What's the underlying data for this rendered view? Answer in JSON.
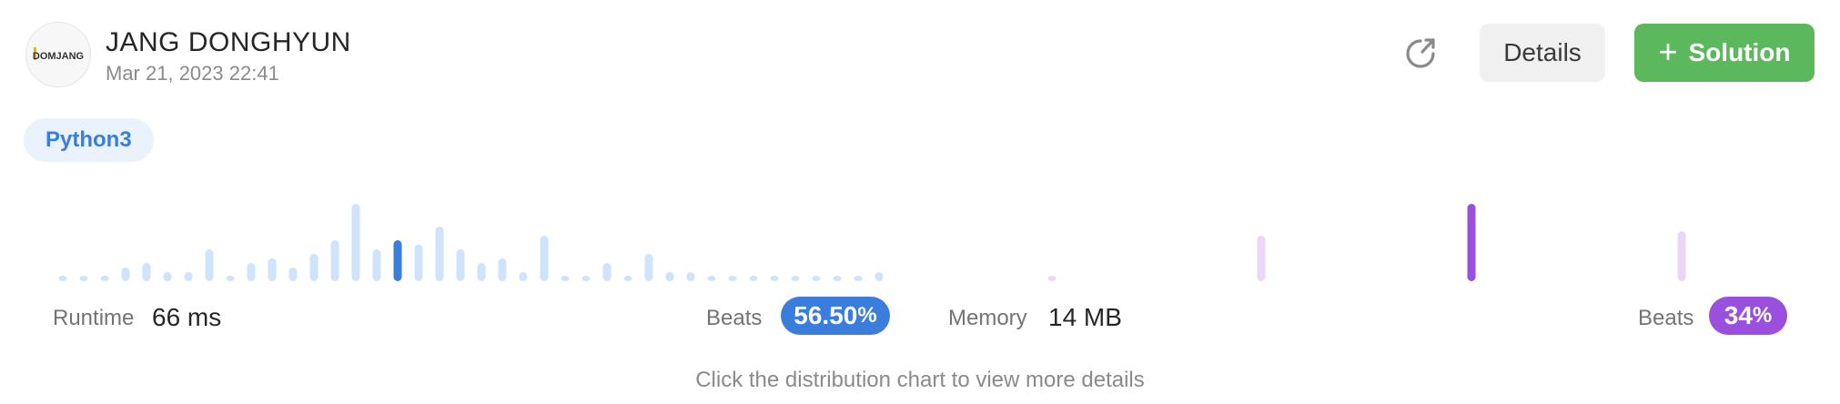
{
  "user": {
    "name": "JANG DONGHYUN",
    "date": "Mar 21, 2023 22:41",
    "avatar_text": "DOMJANG"
  },
  "actions": {
    "details_label": "Details",
    "solution_label": "Solution",
    "solution_plus": "+"
  },
  "language": "Python3",
  "runtime": {
    "label": "Runtime",
    "value": "66 ms",
    "beats_label": "Beats",
    "beats_main": "56.50",
    "beats_unit": "%",
    "accent": "#3b7ddd",
    "muted": "#cfe3fb"
  },
  "memory": {
    "label": "Memory",
    "value": "14 MB",
    "beats_label": "Beats",
    "beats_main": "34",
    "beats_unit": "%",
    "accent": "#9b4fdd",
    "muted": "#ead6f7"
  },
  "hint": "Click the distribution chart to view more details",
  "chart_data": [
    {
      "type": "bar",
      "series": [
        {
          "values": [
            1,
            1,
            1,
            3,
            4,
            2,
            2,
            7,
            1,
            4,
            5,
            3,
            6,
            9,
            17,
            7,
            9,
            8,
            12,
            7,
            4,
            5,
            2,
            10,
            1,
            1,
            4,
            1,
            6,
            2,
            2,
            1,
            1,
            1,
            1,
            1,
            1,
            1,
            1,
            2
          ]
        }
      ],
      "highlight_index": 16
    },
    {
      "type": "bar",
      "series": [
        {
          "values": [
            1,
            10,
            17,
            11
          ]
        }
      ],
      "highlight_index": 2
    }
  ]
}
